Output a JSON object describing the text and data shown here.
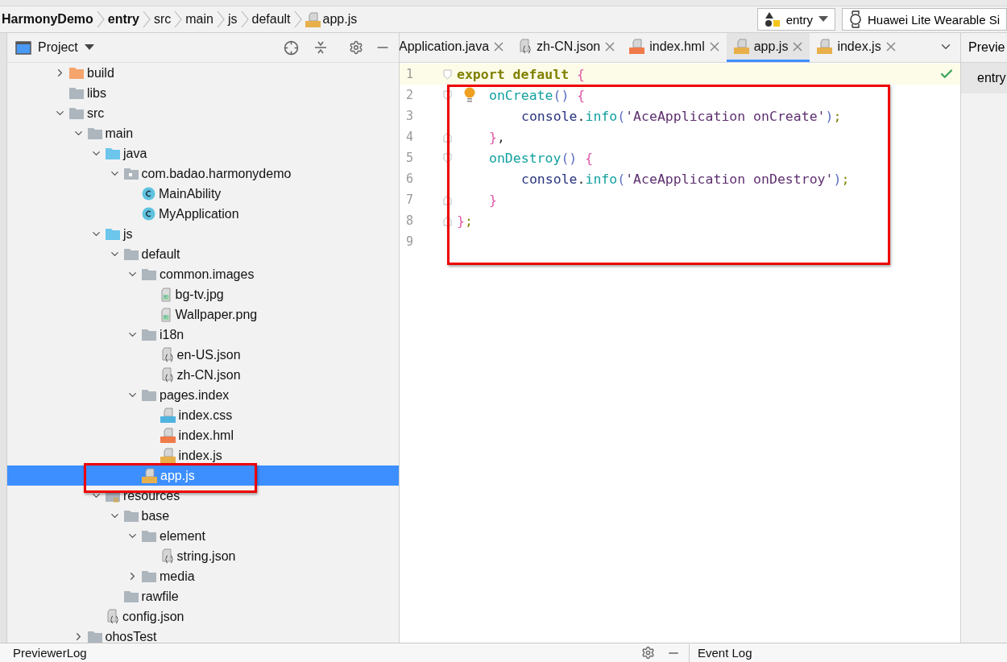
{
  "breadcrumb": [
    {
      "label": "HarmonyDemo",
      "kind": "module"
    },
    {
      "label": "entry",
      "kind": "module"
    },
    {
      "label": "src",
      "kind": "folder"
    },
    {
      "label": "main",
      "kind": "folder"
    },
    {
      "label": "js",
      "kind": "folder"
    },
    {
      "label": "default",
      "kind": "folder"
    },
    {
      "label": "app.js",
      "kind": "js"
    }
  ],
  "run_config": {
    "label": "entry"
  },
  "device": {
    "label": "Huawei Lite Wearable Si"
  },
  "project_panel": {
    "title": "Project",
    "tree": [
      {
        "label": "build",
        "kind": "folder-excluded",
        "expanded": false,
        "selected": false
      },
      {
        "label": "libs",
        "kind": "folder",
        "selected": false
      },
      {
        "label": "src",
        "kind": "folder",
        "expanded": true,
        "selected": false,
        "children": [
          {
            "label": "main",
            "kind": "folder",
            "expanded": true,
            "selected": false,
            "children": [
              {
                "label": "java",
                "kind": "folder-source",
                "expanded": true,
                "selected": false,
                "children": [
                  {
                    "label": "com.badao.harmonydemo",
                    "kind": "package",
                    "expanded": true,
                    "selected": false,
                    "children": [
                      {
                        "label": "MainAbility",
                        "kind": "class",
                        "selected": false
                      },
                      {
                        "label": "MyApplication",
                        "kind": "class",
                        "selected": false
                      }
                    ]
                  }
                ]
              },
              {
                "label": "js",
                "kind": "folder-source",
                "expanded": true,
                "selected": false,
                "children": [
                  {
                    "label": "default",
                    "kind": "folder",
                    "expanded": true,
                    "selected": false,
                    "children": [
                      {
                        "label": "common.images",
                        "kind": "folder",
                        "expanded": true,
                        "selected": false,
                        "children": [
                          {
                            "label": "bg-tv.jpg",
                            "kind": "image",
                            "selected": false
                          },
                          {
                            "label": "Wallpaper.png",
                            "kind": "image",
                            "selected": false
                          }
                        ]
                      },
                      {
                        "label": "i18n",
                        "kind": "folder",
                        "expanded": true,
                        "selected": false,
                        "children": [
                          {
                            "label": "en-US.json",
                            "kind": "json",
                            "selected": false
                          },
                          {
                            "label": "zh-CN.json",
                            "kind": "json",
                            "selected": false
                          }
                        ]
                      },
                      {
                        "label": "pages.index",
                        "kind": "folder",
                        "expanded": true,
                        "selected": false,
                        "children": [
                          {
                            "label": "index.css",
                            "kind": "css",
                            "selected": false
                          },
                          {
                            "label": "index.hml",
                            "kind": "hml",
                            "selected": false
                          },
                          {
                            "label": "index.js",
                            "kind": "js",
                            "selected": false
                          }
                        ]
                      },
                      {
                        "label": "app.js",
                        "kind": "js",
                        "selected": true
                      }
                    ]
                  }
                ]
              },
              {
                "label": "resources",
                "kind": "folder-resources",
                "expanded": true,
                "selected": false,
                "children": [
                  {
                    "label": "base",
                    "kind": "folder",
                    "expanded": true,
                    "selected": false,
                    "children": [
                      {
                        "label": "element",
                        "kind": "folder",
                        "expanded": true,
                        "selected": false,
                        "children": [
                          {
                            "label": "string.json",
                            "kind": "json",
                            "selected": false
                          }
                        ]
                      },
                      {
                        "label": "media",
                        "kind": "folder",
                        "expanded": false,
                        "selected": false
                      }
                    ]
                  },
                  {
                    "label": "rawfile",
                    "kind": "folder",
                    "selected": false
                  }
                ]
              },
              {
                "label": "config.json",
                "kind": "json",
                "selected": false
              }
            ]
          },
          {
            "label": "ohosTest",
            "kind": "folder",
            "expanded": false,
            "selected": false
          }
        ]
      }
    ]
  },
  "editor": {
    "tabs": [
      {
        "label": "Application.java",
        "kind": "java",
        "selected": false
      },
      {
        "label": "zh-CN.json",
        "kind": "json",
        "selected": false
      },
      {
        "label": "index.hml",
        "kind": "hml",
        "selected": false
      },
      {
        "label": "app.js",
        "kind": "js",
        "selected": true
      },
      {
        "label": "index.js",
        "kind": "js",
        "selected": false
      }
    ],
    "lines": [
      {
        "number": "1",
        "kind": "outer",
        "current": true,
        "fold_start": true,
        "fold_end": false,
        "bulb": false,
        "tokens": [
          {
            "kind": "keyword",
            "text": "export default"
          },
          {
            "kind": "brace",
            "text": " {"
          }
        ]
      },
      {
        "number": "2",
        "kind": "member",
        "current": false,
        "fold_start": true,
        "fold_end": false,
        "bulb": true,
        "tokens": [
          {
            "kind": "fn",
            "text": "onCreate"
          },
          {
            "kind": "paren",
            "text": "()"
          },
          {
            "kind": "brace",
            "text": " {"
          }
        ]
      },
      {
        "number": "3",
        "kind": "statement",
        "current": false,
        "fold_start": false,
        "fold_end": false,
        "bulb": false,
        "tokens": [
          {
            "kind": "obj",
            "text": "console"
          },
          {
            "kind": "punct",
            "text": "."
          },
          {
            "kind": "fn",
            "text": "info"
          },
          {
            "kind": "paren",
            "text": "("
          },
          {
            "kind": "string",
            "text": "'AceApplication onCreate'"
          },
          {
            "kind": "paren",
            "text": ")"
          },
          {
            "kind": "semi",
            "text": ";"
          }
        ]
      },
      {
        "number": "4",
        "kind": "member",
        "current": false,
        "fold_start": false,
        "fold_end": true,
        "bulb": false,
        "tokens": [
          {
            "kind": "brace",
            "text": "}"
          },
          {
            "kind": "punct",
            "text": ","
          }
        ]
      },
      {
        "number": "5",
        "kind": "member",
        "current": false,
        "fold_start": true,
        "fold_end": false,
        "bulb": false,
        "tokens": [
          {
            "kind": "fn",
            "text": "onDestroy"
          },
          {
            "kind": "paren",
            "text": "()"
          },
          {
            "kind": "brace",
            "text": " {"
          }
        ]
      },
      {
        "number": "6",
        "kind": "statement",
        "current": false,
        "fold_start": false,
        "fold_end": false,
        "bulb": false,
        "tokens": [
          {
            "kind": "obj",
            "text": "console"
          },
          {
            "kind": "punct",
            "text": "."
          },
          {
            "kind": "fn",
            "text": "info"
          },
          {
            "kind": "paren",
            "text": "("
          },
          {
            "kind": "string",
            "text": "'AceApplication onDestroy'"
          },
          {
            "kind": "paren",
            "text": ")"
          },
          {
            "kind": "semi",
            "text": ";"
          }
        ]
      },
      {
        "number": "7",
        "kind": "member",
        "current": false,
        "fold_start": false,
        "fold_end": true,
        "bulb": false,
        "tokens": [
          {
            "kind": "brace",
            "text": "}"
          }
        ]
      },
      {
        "number": "8",
        "kind": "outer",
        "current": false,
        "fold_start": false,
        "fold_end": true,
        "bulb": false,
        "tokens": [
          {
            "kind": "brace",
            "text": "}"
          },
          {
            "kind": "semi",
            "text": ";"
          }
        ]
      },
      {
        "number": "9",
        "current": false,
        "fold_start": false,
        "fold_end": false,
        "bulb": false
      }
    ],
    "inspection_ok": true
  },
  "annotations": {
    "code_block": true,
    "selected_file": true
  },
  "preview_panel": {
    "title": "Previe",
    "item": "entry"
  },
  "bottom_bar": {
    "left_tab": "PreviewerLog",
    "right_tab": "Event Log"
  }
}
